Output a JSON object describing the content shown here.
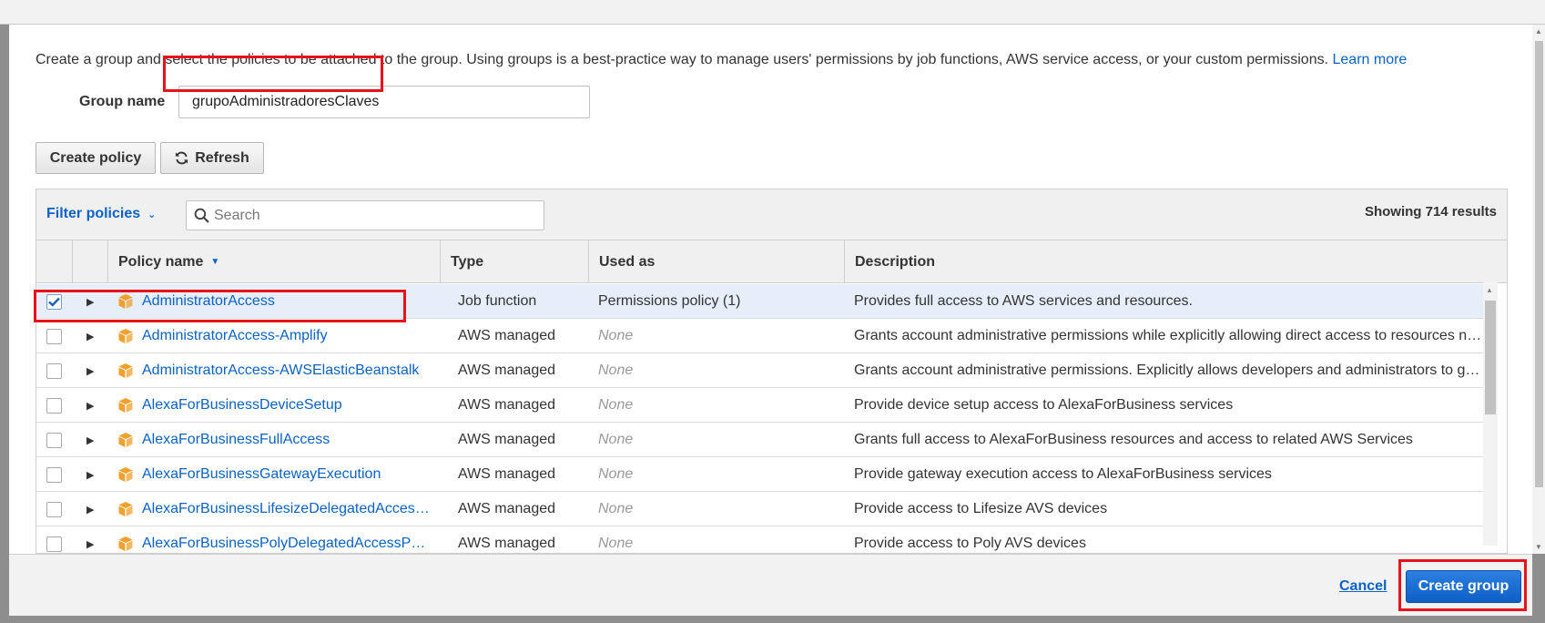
{
  "intro": {
    "text": "Create a group and select the policies to be attached to the group. Using groups is a best-practice way to manage users' permissions by job functions, AWS service access, or your custom permissions.",
    "link": "Learn more"
  },
  "group": {
    "label": "Group name",
    "value": "grupoAdministradoresClaves"
  },
  "toolbar": {
    "create_policy": "Create policy",
    "refresh": "Refresh"
  },
  "filter": {
    "label": "Filter policies",
    "search_placeholder": "Search",
    "showing": "Showing 714 results"
  },
  "columns": {
    "policy_name": "Policy name",
    "type": "Type",
    "used_as": "Used as",
    "description": "Description"
  },
  "rows": [
    {
      "name": "AdministratorAccess",
      "type": "Job function",
      "used_as": "Permissions policy (1)",
      "description": "Provides full access to AWS services and resources.",
      "checked": true
    },
    {
      "name": "AdministratorAccess-Amplify",
      "type": "AWS managed",
      "used_as": "None",
      "description": "Grants account administrative permissions while explicitly allowing direct access to resources needed by Amplify applications.",
      "checked": false
    },
    {
      "name": "AdministratorAccess-AWSElasticBeanstalk",
      "type": "AWS managed",
      "used_as": "None",
      "description": "Grants account administrative permissions. Explicitly allows developers and administrators to gain direct access to resources they need to manage AWS Elastic Beanstalk applications.",
      "checked": false
    },
    {
      "name": "AlexaForBusinessDeviceSetup",
      "type": "AWS managed",
      "used_as": "None",
      "description": "Provide device setup access to AlexaForBusiness services",
      "checked": false
    },
    {
      "name": "AlexaForBusinessFullAccess",
      "type": "AWS managed",
      "used_as": "None",
      "description": "Grants full access to AlexaForBusiness resources and access to related AWS Services",
      "checked": false
    },
    {
      "name": "AlexaForBusinessGatewayExecution",
      "type": "AWS managed",
      "used_as": "None",
      "description": "Provide gateway execution access to AlexaForBusiness services",
      "checked": false
    },
    {
      "name": "AlexaForBusinessLifesizeDelegatedAccessPolicy",
      "type": "AWS managed",
      "used_as": "None",
      "description": "Provide access to Lifesize AVS devices",
      "checked": false
    },
    {
      "name": "AlexaForBusinessPolyDelegatedAccessPolicy",
      "type": "AWS managed",
      "used_as": "None",
      "description": "Provide access to Poly AVS devices",
      "checked": false
    }
  ],
  "footer": {
    "cancel": "Cancel",
    "create_group": "Create group"
  },
  "colors": {
    "link": "#0b62c4",
    "highlight": "#e8121b",
    "primary": "#1a6fd6",
    "policy_icon": "#f0a02c"
  },
  "icons": {
    "policy": "cube-icon",
    "refresh": "refresh-icon",
    "search": "search-icon",
    "expand": "caret-right-icon"
  }
}
